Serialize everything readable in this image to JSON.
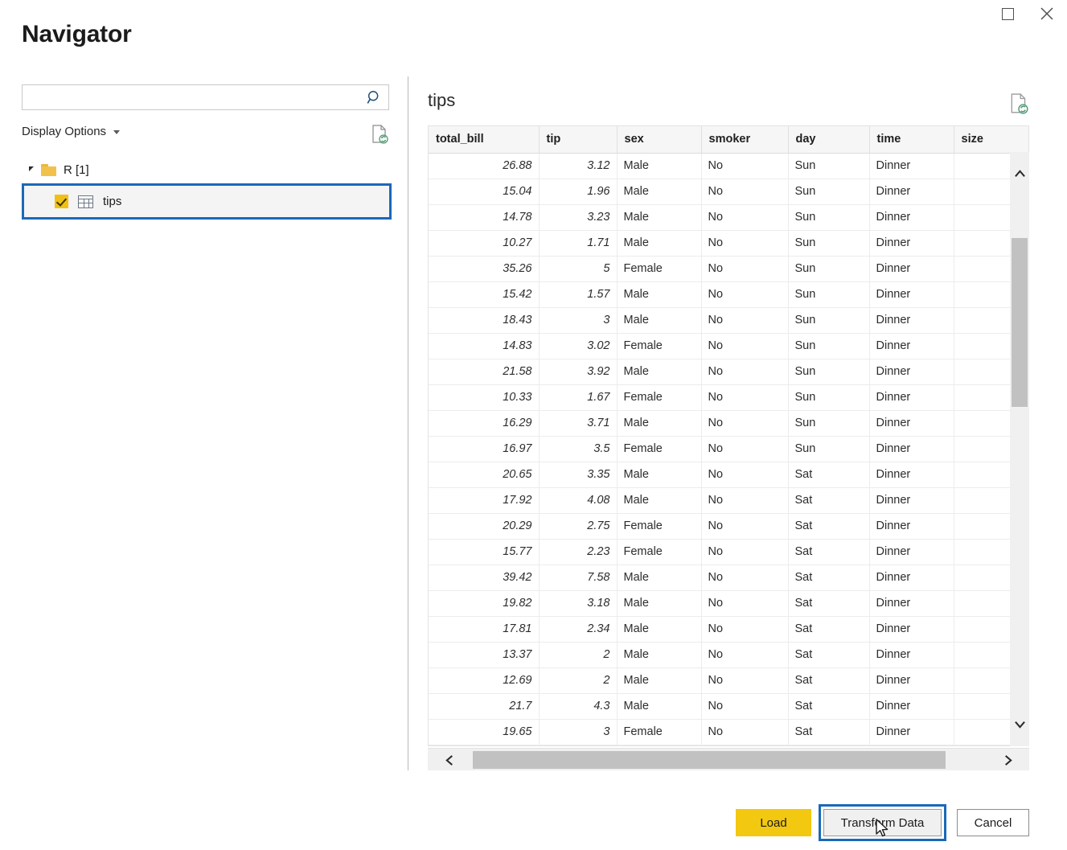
{
  "window": {
    "title": "Navigator",
    "controls": [
      {
        "name": "maximize-button",
        "icon": "maximize-icon"
      },
      {
        "name": "close-button",
        "icon": "close-icon"
      }
    ]
  },
  "left_pane": {
    "search": {
      "value": "",
      "placeholder": "",
      "icon": "search-icon"
    },
    "display_options_label": "Display Options",
    "refresh_icon": "document-refresh-icon",
    "tree": {
      "root": {
        "label": "R [1]",
        "expanded": true,
        "icon": "folder-icon"
      },
      "items": [
        {
          "label": "tips",
          "checked": true,
          "selected": true,
          "icon": "table-icon"
        }
      ]
    }
  },
  "preview": {
    "title": "tips",
    "refresh_icon": "document-refresh-icon",
    "columns": [
      "total_bill",
      "tip",
      "sex",
      "smoker",
      "day",
      "time",
      "size"
    ],
    "rows": [
      [
        "26.88",
        "3.12",
        "Male",
        "No",
        "Sun",
        "Dinner",
        ""
      ],
      [
        "15.04",
        "1.96",
        "Male",
        "No",
        "Sun",
        "Dinner",
        ""
      ],
      [
        "14.78",
        "3.23",
        "Male",
        "No",
        "Sun",
        "Dinner",
        ""
      ],
      [
        "10.27",
        "1.71",
        "Male",
        "No",
        "Sun",
        "Dinner",
        ""
      ],
      [
        "35.26",
        "5",
        "Female",
        "No",
        "Sun",
        "Dinner",
        ""
      ],
      [
        "15.42",
        "1.57",
        "Male",
        "No",
        "Sun",
        "Dinner",
        ""
      ],
      [
        "18.43",
        "3",
        "Male",
        "No",
        "Sun",
        "Dinner",
        ""
      ],
      [
        "14.83",
        "3.02",
        "Female",
        "No",
        "Sun",
        "Dinner",
        ""
      ],
      [
        "21.58",
        "3.92",
        "Male",
        "No",
        "Sun",
        "Dinner",
        ""
      ],
      [
        "10.33",
        "1.67",
        "Female",
        "No",
        "Sun",
        "Dinner",
        ""
      ],
      [
        "16.29",
        "3.71",
        "Male",
        "No",
        "Sun",
        "Dinner",
        ""
      ],
      [
        "16.97",
        "3.5",
        "Female",
        "No",
        "Sun",
        "Dinner",
        ""
      ],
      [
        "20.65",
        "3.35",
        "Male",
        "No",
        "Sat",
        "Dinner",
        ""
      ],
      [
        "17.92",
        "4.08",
        "Male",
        "No",
        "Sat",
        "Dinner",
        ""
      ],
      [
        "20.29",
        "2.75",
        "Female",
        "No",
        "Sat",
        "Dinner",
        ""
      ],
      [
        "15.77",
        "2.23",
        "Female",
        "No",
        "Sat",
        "Dinner",
        ""
      ],
      [
        "39.42",
        "7.58",
        "Male",
        "No",
        "Sat",
        "Dinner",
        ""
      ],
      [
        "19.82",
        "3.18",
        "Male",
        "No",
        "Sat",
        "Dinner",
        ""
      ],
      [
        "17.81",
        "2.34",
        "Male",
        "No",
        "Sat",
        "Dinner",
        ""
      ],
      [
        "13.37",
        "2",
        "Male",
        "No",
        "Sat",
        "Dinner",
        ""
      ],
      [
        "12.69",
        "2",
        "Male",
        "No",
        "Sat",
        "Dinner",
        ""
      ],
      [
        "21.7",
        "4.3",
        "Male",
        "No",
        "Sat",
        "Dinner",
        ""
      ],
      [
        "19.65",
        "3",
        "Female",
        "No",
        "Sat",
        "Dinner",
        ""
      ]
    ],
    "scrollbars": {
      "vertical": {
        "up_icon": "chevron-up-icon",
        "down_icon": "chevron-down-icon"
      },
      "horizontal": {
        "left_icon": "chevron-left-icon",
        "right_icon": "chevron-right-icon"
      }
    }
  },
  "footer": {
    "load_label": "Load",
    "transform_label": "Transform Data",
    "cancel_label": "Cancel"
  },
  "colors": {
    "accent_blue": "#1a69b8",
    "load_yellow": "#f2c811",
    "checkbox_yellow": "#f2c014",
    "folder_yellow": "#f2c14a"
  }
}
